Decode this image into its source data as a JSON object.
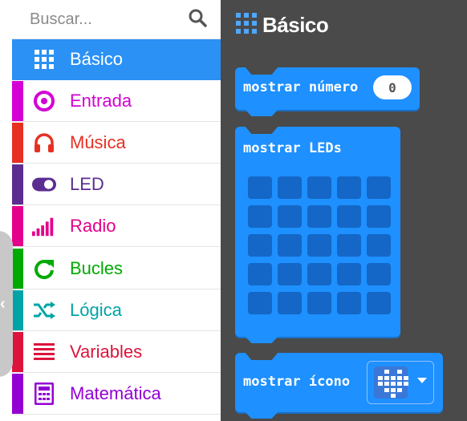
{
  "search": {
    "placeholder": "Buscar..."
  },
  "categories": [
    {
      "label": "Básico",
      "color": "#2b91f5",
      "icon": "grid-icon",
      "selected": true
    },
    {
      "label": "Entrada",
      "color": "#d400d4",
      "icon": "target-icon"
    },
    {
      "label": "Música",
      "color": "#e63022",
      "icon": "headphones-icon"
    },
    {
      "label": "LED",
      "color": "#5c2d91",
      "icon": "toggle-icon"
    },
    {
      "label": "Radio",
      "color": "#e3008c",
      "icon": "signal-bars-icon"
    },
    {
      "label": "Bucles",
      "color": "#00aa00",
      "icon": "refresh-icon"
    },
    {
      "label": "Lógica",
      "color": "#00a4a6",
      "icon": "shuffle-icon"
    },
    {
      "label": "Variables",
      "color": "#dc143c",
      "icon": "list-lines-icon"
    },
    {
      "label": "Matemática",
      "color": "#9400d3",
      "icon": "calculator-icon"
    }
  ],
  "flyout": {
    "title": "Básico",
    "blocks": {
      "show_number": {
        "label": "mostrar número",
        "value": "0"
      },
      "show_leds": {
        "label": "mostrar LEDs"
      },
      "show_icon": {
        "label": "mostrar ícono",
        "selected_icon": "heart-icon"
      }
    }
  },
  "colors": {
    "block": "#1e90ff",
    "flyout_bg": "#4a4a4a",
    "selected": "#2b91f5"
  }
}
